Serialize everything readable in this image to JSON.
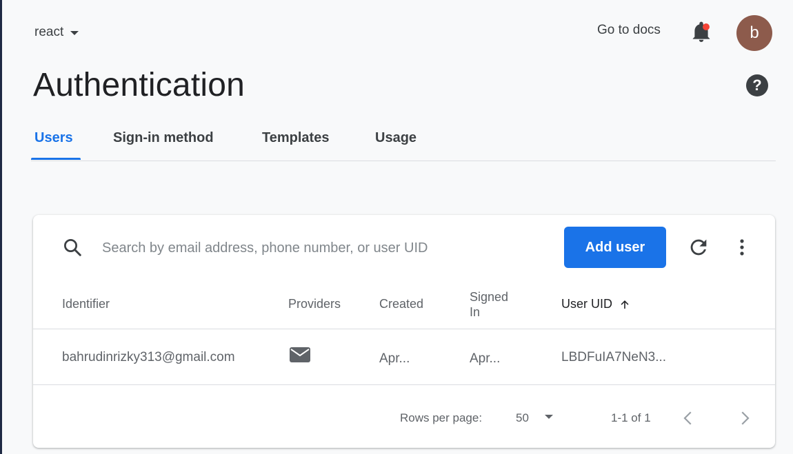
{
  "header": {
    "project": "react",
    "docs_link": "Go to docs",
    "avatar_letter": "b",
    "icons": [
      "chevron-down-icon",
      "bell-icon",
      "help-icon"
    ]
  },
  "page": {
    "title": "Authentication"
  },
  "tabs": [
    {
      "label": "Users",
      "active": true
    },
    {
      "label": "Sign-in method",
      "active": false
    },
    {
      "label": "Templates",
      "active": false
    },
    {
      "label": "Usage",
      "active": false
    }
  ],
  "toolbar": {
    "search_placeholder": "Search by email address, phone number, or user UID",
    "search_value": "",
    "add_user_label": "Add user",
    "icons": [
      "search-icon",
      "refresh-icon",
      "more-vert-icon"
    ]
  },
  "table": {
    "columns": [
      "Identifier",
      "Providers",
      "Created",
      "Signed In",
      "User UID"
    ],
    "sorted_column": "User UID",
    "sort_direction": "ascending",
    "rows": [
      {
        "identifier": "bahrudinrizky313@gmail.com",
        "provider_icon": "mail-icon",
        "created": "Apr...",
        "signed_in": "Apr...",
        "uid": "LBDFuIA7NeN3..."
      }
    ]
  },
  "pagination": {
    "rows_per_page_label": "Rows per page:",
    "rows_per_page": "50",
    "range": "1-1 of 1"
  },
  "colors": {
    "accent": "#1a73e8",
    "avatar": "#8d5b4c",
    "notification_dot": "#f44336",
    "background": "#f8f9fa"
  }
}
